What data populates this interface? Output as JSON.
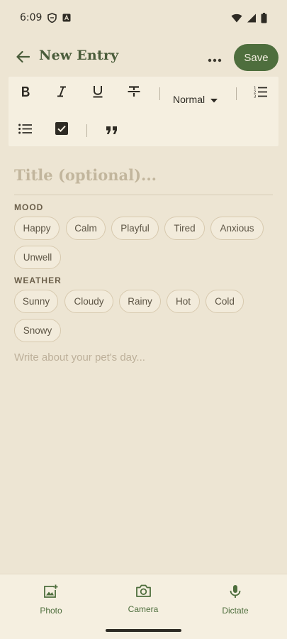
{
  "status_bar": {
    "time": "6:09",
    "icons_left": [
      "shield-icon",
      "a-badge-icon"
    ],
    "icons_right": [
      "wifi-icon",
      "signal-icon",
      "battery-icon"
    ]
  },
  "app_bar": {
    "title": "New Entry",
    "save_label": "Save",
    "back_icon": "arrow-left-icon",
    "more_icon": "more-horizontal-icon"
  },
  "toolbar": {
    "buttons": [
      "bold",
      "italic",
      "underline",
      "strikethrough",
      "numbered-list",
      "bulleted-list",
      "checklist",
      "quote"
    ],
    "heading_value": "Normal"
  },
  "entry": {
    "title_placeholder": "Title (optional)...",
    "body_placeholder": "Write about your pet's day..."
  },
  "mood": {
    "label": "MOOD",
    "options": [
      "Happy",
      "Calm",
      "Playful",
      "Tired",
      "Anxious",
      "Unwell"
    ]
  },
  "weather": {
    "label": "WEATHER",
    "options": [
      "Sunny",
      "Cloudy",
      "Rainy",
      "Hot",
      "Cold",
      "Snowy"
    ]
  },
  "bottom_bar": {
    "photo_label": "Photo",
    "camera_label": "Camera",
    "dictate_label": "Dictate"
  },
  "colors": {
    "background": "#EDE5D3",
    "accent": "#4E6E3D",
    "toolbar_bg": "#F5EFE0",
    "chip_border": "#D7C9AE"
  }
}
